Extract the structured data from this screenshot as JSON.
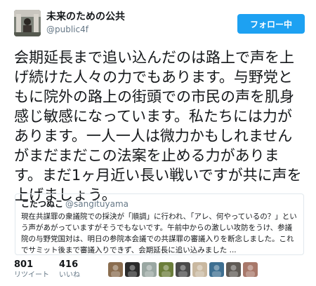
{
  "author": {
    "display_name": "未来のための公共",
    "handle": "@public4f",
    "avatar_icon": "avatar-icon"
  },
  "follow_button": {
    "label": "フォロー中"
  },
  "tweet": {
    "text": "会期延長まで追い込んだのは路上で声を上げ続けた人々の力でもあります。与野党ともに院外の路上の街頭での市民の声を肌身感じ敏感になっています。私たちには力があります。一人一人は微力かもしれませんがまだまだこの法案を止める力があります。まだ1ヶ月近い長い戦いですが共に声を上げましょう。"
  },
  "quoted_tweet": {
    "display_name": "こたつぬこ",
    "handle": "@sangituyama",
    "text": "現在共謀罪の衆議院での採決が「順調」に行われ、「アレ、何やっているの？」という声があがっていますがそうでもないです。午前中からの激しい攻防をうけ、参議院の与野党国対は、明日の参院本会議での共謀罪の審議入りを断念しました。これでサミット後まで審議入りできず、会期延長に追い込みました ..."
  },
  "stats": {
    "retweets": {
      "count": "801",
      "label": "リツイート"
    },
    "likes": {
      "count": "416",
      "label": "いいね"
    }
  },
  "likers": [
    {
      "name": "liker-avatar-1",
      "color": "#8a6d4f"
    },
    {
      "name": "liker-avatar-2",
      "color": "#2b2b2b"
    },
    {
      "name": "liker-avatar-3",
      "color": "#9aa7a2"
    },
    {
      "name": "liker-avatar-4",
      "color": "#6b7d3a"
    },
    {
      "name": "liker-avatar-5",
      "color": "#4a4a4a"
    },
    {
      "name": "liker-avatar-6",
      "color": "#c9b8a0"
    },
    {
      "name": "liker-avatar-7",
      "color": "#3e6f91"
    },
    {
      "name": "liker-avatar-8",
      "color": "#5f5a55"
    },
    {
      "name": "liker-avatar-9",
      "color": "#a8786a"
    }
  ],
  "colors": {
    "accent": "#1da1f2",
    "text": "#14171a",
    "muted": "#657786",
    "border": "#e1e8ed"
  }
}
